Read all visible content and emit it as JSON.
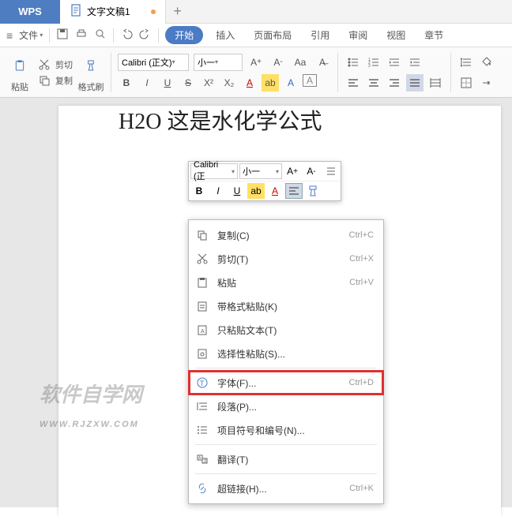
{
  "app": {
    "logo": "WPS",
    "tab_title": "文字文稿1"
  },
  "menu": {
    "file": "文件",
    "items": [
      "插入",
      "页面布局",
      "引用",
      "审阅",
      "视图",
      "章节"
    ],
    "active": "开始"
  },
  "ribbon": {
    "paste": "粘贴",
    "cut": "剪切",
    "copy": "复制",
    "format_painter": "格式刷",
    "font_name": "Calibri (正文)",
    "font_size": "小一",
    "bold": "B",
    "italic": "I",
    "underline": "U",
    "strike": "S"
  },
  "mini": {
    "font_name": "Calibri (正",
    "font_size": "小一",
    "bold": "B",
    "italic": "I",
    "underline": "U"
  },
  "doc": {
    "text": "H2O 这是水化学公式"
  },
  "ctx": {
    "copy": "复制(C)",
    "copy_sc": "Ctrl+C",
    "cut": "剪切(T)",
    "cut_sc": "Ctrl+X",
    "paste": "粘贴",
    "paste_sc": "Ctrl+V",
    "paste_fmt": "带格式粘贴(K)",
    "paste_text": "只粘贴文本(T)",
    "paste_sel": "选择性粘贴(S)...",
    "font": "字体(F)...",
    "font_sc": "Ctrl+D",
    "paragraph": "段落(P)...",
    "bullets": "项目符号和编号(N)...",
    "translate": "翻译(T)",
    "hyperlink": "超链接(H)...",
    "hyperlink_sc": "Ctrl+K"
  },
  "watermark": {
    "main": "软件自学网",
    "sub": "WWW.RJZXW.COM"
  }
}
